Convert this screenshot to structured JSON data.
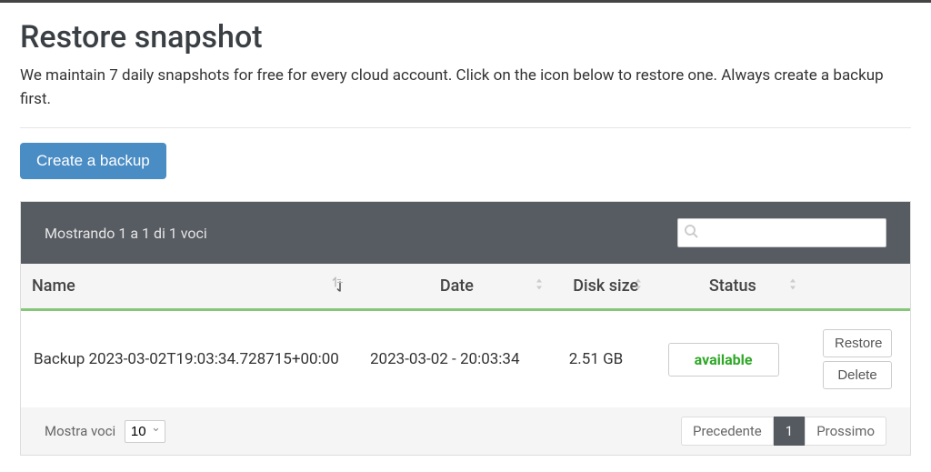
{
  "page": {
    "title": "Restore snapshot",
    "description": "We maintain 7 daily snapshots for free for every cloud account. Click on the icon below to restore one. Always create a backup first.",
    "create_backup_label": "Create a backup"
  },
  "table": {
    "info_text": "Mostrando 1 a 1 di 1 voci",
    "search_placeholder": "",
    "columns": {
      "name": "Name",
      "date": "Date",
      "disk_size": "Disk size",
      "status": "Status"
    },
    "rows": [
      {
        "name": "Backup 2023-03-02T19:03:34.728715+00:00",
        "date": "2023-03-02 - 20:03:34",
        "disk_size": "2.51 GB",
        "status": "available"
      }
    ],
    "actions": {
      "restore": "Restore",
      "delete": "Delete"
    },
    "length_label": "Mostra voci",
    "length_value": "10",
    "paginate": {
      "prev": "Precedente",
      "current": "1",
      "next": "Prossimo"
    }
  }
}
